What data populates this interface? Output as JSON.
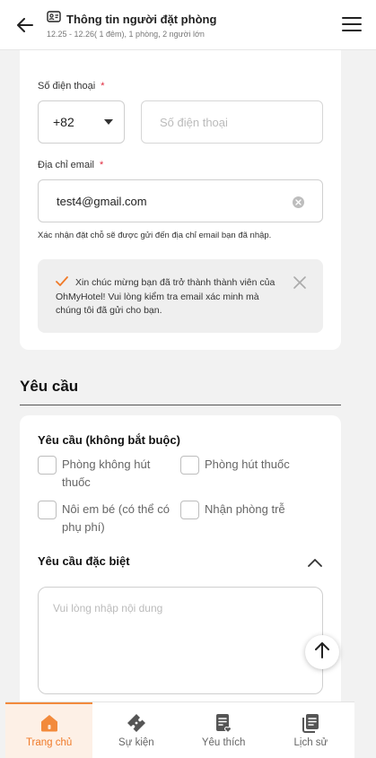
{
  "header": {
    "title": "Thông tin người đặt phòng",
    "subtitle": "12.25 - 12.26( 1 đêm), 1 phòng, 2 người lớn"
  },
  "contact": {
    "phone_label": "Số điện thoại",
    "required_mark": "*",
    "country_code": "+82",
    "phone_placeholder": "Số điện thoại",
    "email_label": "Địa chỉ email",
    "email_value": "test4@gmail.com",
    "email_hint": "Xác nhận đặt chỗ sẽ được gửi đến địa chỉ email bạn đã nhập.",
    "notice_text": "Xin chúc mừng bạn đã trở thành thành viên của OhMyHotel! Vui lòng kiểm tra email xác minh mà chúng tôi đã gửi cho bạn."
  },
  "requests": {
    "section_title": "Yêu cầu",
    "optional_title": "Yêu cầu (không bắt buộc)",
    "options": [
      {
        "label": "Phòng không hút thuốc"
      },
      {
        "label": "Phòng hút thuốc"
      },
      {
        "label": "Nôi em bé (có thể có phụ phí)"
      },
      {
        "label": "Nhận phòng trễ"
      }
    ],
    "special_title": "Yêu cầu đặc biệt",
    "special_placeholder": "Vui lòng nhập nội dung"
  },
  "nav": {
    "items": [
      {
        "label": "Trang chủ",
        "icon": "home-icon",
        "active": true
      },
      {
        "label": "Sự kiện",
        "icon": "ticket-icon",
        "active": false
      },
      {
        "label": "Yêu thích",
        "icon": "favorite-list-icon",
        "active": false
      },
      {
        "label": "Lịch sử",
        "icon": "history-icon",
        "active": false
      }
    ]
  },
  "colors": {
    "accent": "#f07a28",
    "required": "#e0293d"
  }
}
